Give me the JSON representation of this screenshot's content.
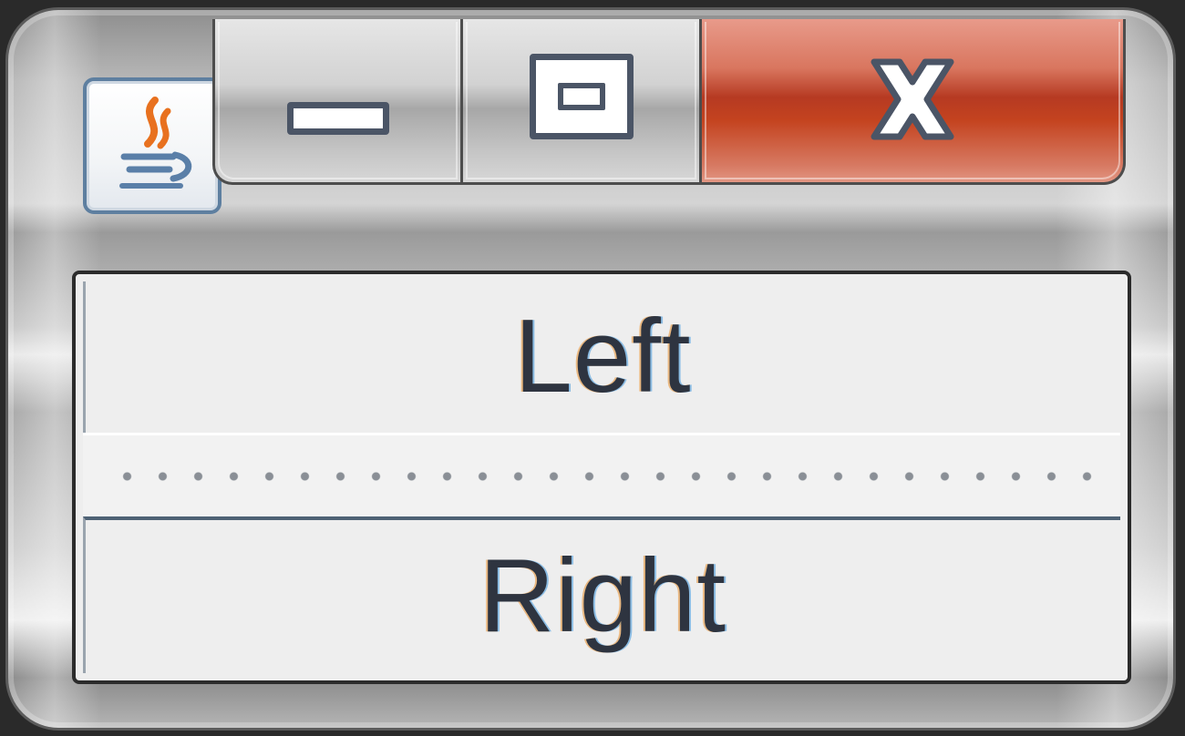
{
  "window": {
    "icon": "java-coffee-cup-icon",
    "controls": {
      "minimize_icon": "minimize-icon",
      "maximize_icon": "maximize-icon",
      "close_icon": "close-icon",
      "close_color": "#c4431f"
    }
  },
  "split_pane": {
    "orientation": "vertical",
    "top_label": "Left",
    "bottom_label": "Right"
  }
}
